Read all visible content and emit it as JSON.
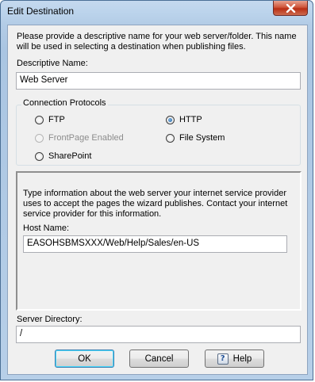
{
  "window": {
    "title": "Edit Destination"
  },
  "intro_text": "Please provide a descriptive name for your web server/folder. This name will be used in selecting a destination when publishing files.",
  "descriptive_name": {
    "label": "Descriptive Name:",
    "value": "Web Server"
  },
  "connection_protocols": {
    "title": "Connection Protocols",
    "options": [
      {
        "label": "FTP",
        "checked": false,
        "enabled": true
      },
      {
        "label": "HTTP",
        "checked": true,
        "enabled": true
      },
      {
        "label": "FrontPage Enabled",
        "checked": false,
        "enabled": false
      },
      {
        "label": "File System",
        "checked": false,
        "enabled": true
      },
      {
        "label": "SharePoint",
        "checked": false,
        "enabled": true
      }
    ]
  },
  "http_panel": {
    "info_text": "Type information about the web server your internet service provider uses to accept the pages the wizard publishes. Contact your internet service provider for this information.",
    "host_name_label": "Host Name:",
    "host_name_value": "EASOHSBMSXXX/Web/Help/Sales/en-US"
  },
  "server_directory": {
    "label": "Server Directory:",
    "value": "/"
  },
  "buttons": {
    "ok": "OK",
    "cancel": "Cancel",
    "help": "Help",
    "help_icon_glyph": "?"
  },
  "colors": {
    "accent_border": "#3c7fb1",
    "close_button": "#c8412a",
    "radio_checked": "#1d5fa0"
  }
}
